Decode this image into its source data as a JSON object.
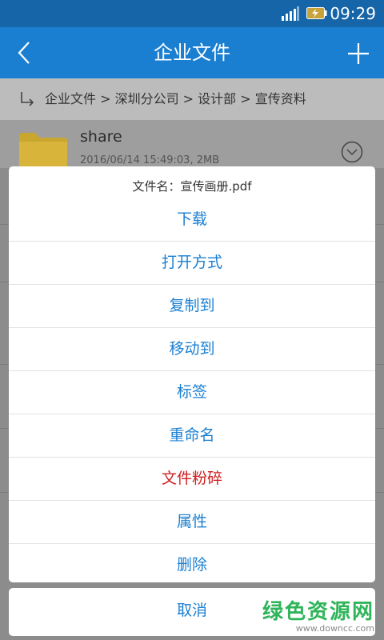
{
  "status_bar": {
    "time": "09:29",
    "signal_icon": "signal-icon",
    "battery_icon": "battery-charging-icon"
  },
  "app_bar": {
    "title": "企业文件",
    "back_icon": "back-chevron-icon",
    "add_icon": "plus-icon"
  },
  "breadcrumb": {
    "path": "企业文件 > 深圳分公司 > 设计部 > 宣传资料"
  },
  "file": {
    "name": "share",
    "meta": "2016/06/14 15:49:03, 2MB",
    "icon": "folder-icon"
  },
  "sheet": {
    "header": "文件名：宣传画册.pdf",
    "options": [
      {
        "label": "下载"
      },
      {
        "label": "打开方式"
      },
      {
        "label": "复制到"
      },
      {
        "label": "移动到"
      },
      {
        "label": "标签"
      },
      {
        "label": "重命名"
      },
      {
        "label": "文件粉碎"
      },
      {
        "label": "属性"
      },
      {
        "label": "删除"
      }
    ],
    "cancel": "取消"
  },
  "watermark": {
    "cn": "绿色资源网",
    "url": "www.downcc.com"
  },
  "colors": {
    "primary": "#1b7fd1",
    "danger": "#d01f1f",
    "status_bar": "#1565a8"
  }
}
